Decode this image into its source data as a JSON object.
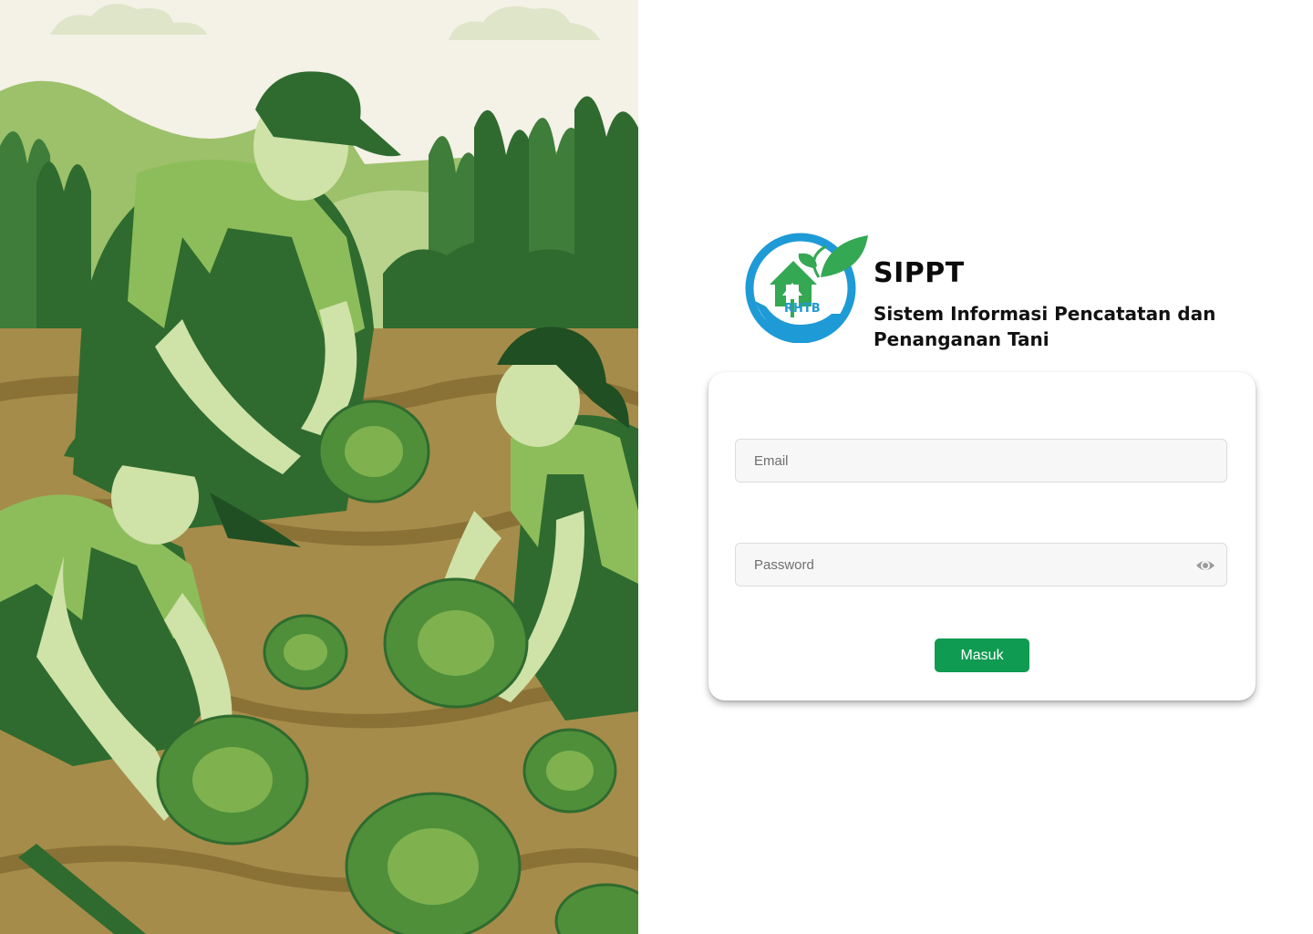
{
  "brand": {
    "title": "SIPPT",
    "subtitle": "Sistem Informasi Pencatatan dan Penanganan Tani",
    "logo_text": "RHTB"
  },
  "login": {
    "email_placeholder": "Email",
    "password_placeholder": "Password",
    "submit_label": "Masuk",
    "password_toggle_icon": "eye-icon"
  },
  "colors": {
    "accent": "#0f9b52",
    "logo_blue": "#1e9ad6",
    "logo_green": "#34a853"
  }
}
